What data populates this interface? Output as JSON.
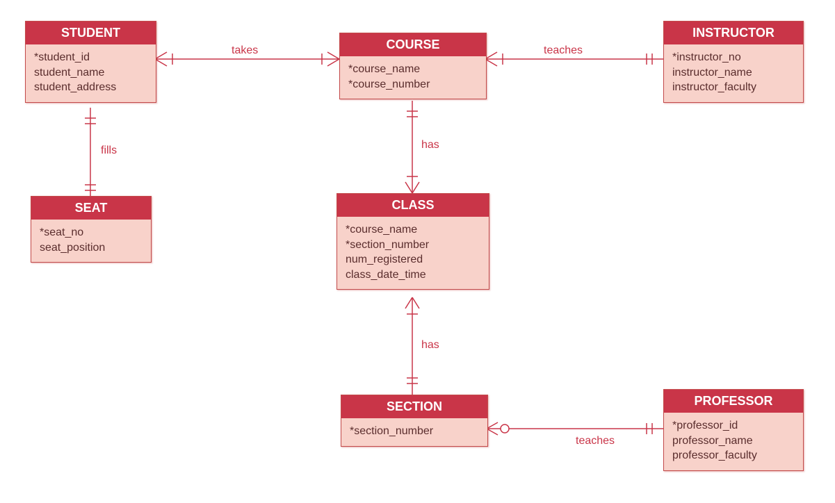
{
  "entities": {
    "student": {
      "title": "STUDENT",
      "attrs": [
        "*student_id",
        "student_name",
        "student_address"
      ]
    },
    "course": {
      "title": "COURSE",
      "attrs": [
        "*course_name",
        "*course_number"
      ]
    },
    "instructor": {
      "title": "INSTRUCTOR",
      "attrs": [
        "*instructor_no",
        "instructor_name",
        "instructor_faculty"
      ]
    },
    "seat": {
      "title": "SEAT",
      "attrs": [
        "*seat_no",
        "seat_position"
      ]
    },
    "class": {
      "title": "CLASS",
      "attrs": [
        "*course_name",
        "*section_number",
        "num_registered",
        "class_date_time"
      ]
    },
    "section": {
      "title": "SECTION",
      "attrs": [
        "*section_number"
      ]
    },
    "professor": {
      "title": "PROFESSOR",
      "attrs": [
        "*professor_id",
        "professor_name",
        "professor_faculty"
      ]
    }
  },
  "relationships": {
    "takes": "takes",
    "teaches1": "teaches",
    "fills": "fills",
    "has1": "has",
    "has2": "has",
    "teaches2": "teaches"
  },
  "colors": {
    "header": "#c93548",
    "body": "#f8d2ca",
    "line": "#c93548"
  }
}
